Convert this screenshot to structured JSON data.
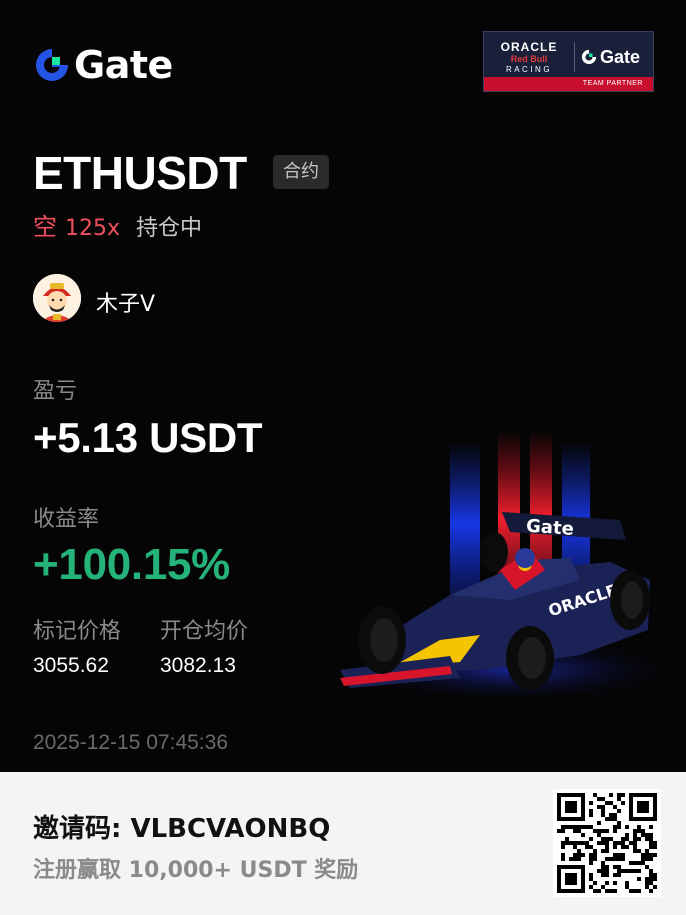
{
  "brand": {
    "name": "Gate"
  },
  "partner": {
    "oracle": "ORACLE",
    "redbull": "Red Bull",
    "racing": "RACING",
    "gate": "Gate",
    "caption": "TEAM PARTNER"
  },
  "position": {
    "pair": "ETHUSDT",
    "type_tag": "合约",
    "side": "空",
    "leverage": "125x",
    "status": "持仓中"
  },
  "user": {
    "name": "木子V"
  },
  "stats": {
    "pnl_label": "盈亏",
    "pnl_value": "+5.13 USDT",
    "roi_label": "收益率",
    "roi_value": "+100.15%",
    "mark_price_label": "标记价格",
    "mark_price": "3055.62",
    "entry_price_label": "开仓均价",
    "entry_price": "3082.13"
  },
  "timestamp": "2025-12-15 07:45:36",
  "car": {
    "wing_text": "Gate",
    "sidepod_text": "ORACLE"
  },
  "footer": {
    "invite": "邀请码: VLBCVAONBQ",
    "reward": "注册赢取 10,000+ USDT 奖励"
  },
  "colors": {
    "brand_blue": "#2354e6",
    "brand_green": "#17e6a1",
    "short_red": "#f0505e",
    "profit_green": "#26b37a"
  }
}
